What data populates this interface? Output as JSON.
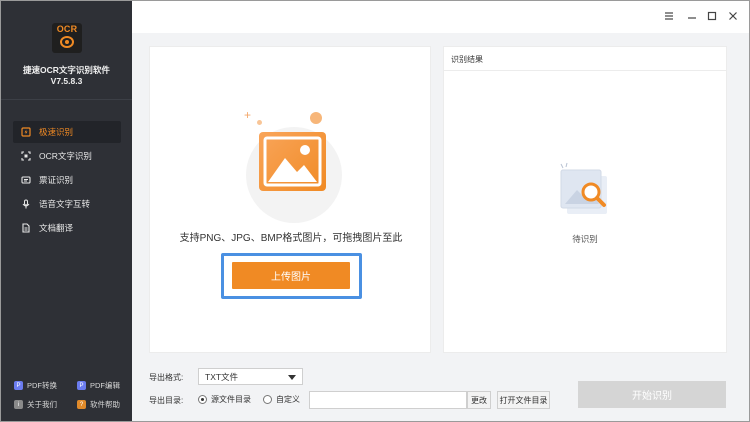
{
  "app": {
    "logo_text": "OCR",
    "name": "捷速OCR文字识别软件",
    "version": "V7.5.8.3"
  },
  "sidebar": {
    "items": [
      {
        "label": "极速识别",
        "icon": "lightning-doc-icon",
        "active": true
      },
      {
        "label": "OCR文字识别",
        "icon": "scan-frame-icon",
        "active": false
      },
      {
        "label": "票证识别",
        "icon": "ticket-icon",
        "active": false
      },
      {
        "label": "语音文字互转",
        "icon": "microphone-icon",
        "active": false
      },
      {
        "label": "文档翻译",
        "icon": "translate-doc-icon",
        "active": false
      }
    ],
    "bottom_links": [
      {
        "label": "PDF转换",
        "icon": "pdf-convert-icon",
        "color": "#6b7cf0"
      },
      {
        "label": "PDF编辑",
        "icon": "pdf-edit-icon",
        "color": "#6b7cf0"
      },
      {
        "label": "关于我们",
        "icon": "info-icon",
        "color": "#8a8a8a"
      },
      {
        "label": "软件帮助",
        "icon": "help-icon",
        "color": "#e08a2a"
      }
    ]
  },
  "window_controls": [
    "menu-icon",
    "minimize-icon",
    "maximize-icon",
    "close-icon"
  ],
  "upload": {
    "hint": "支持PNG、JPG、BMP格式图片，可拖拽图片至此",
    "button_label": "上传图片"
  },
  "result": {
    "title": "识别结果",
    "pending_text": "待识别"
  },
  "export": {
    "format_label": "导出格式:",
    "format_value": "TXT文件",
    "dir_label": "导出目录:",
    "radio_source": "源文件目录",
    "radio_custom": "自定义",
    "selected_radio": "source",
    "path_value": "",
    "change_button": "更改",
    "open_dir_button": "打开文件目录"
  },
  "start_button": "开始识别",
  "colors": {
    "accent": "#f08a24",
    "sidebar_bg": "#2e3036",
    "focus_outline": "#4a90e2",
    "disabled_button": "#d5d5d5"
  }
}
